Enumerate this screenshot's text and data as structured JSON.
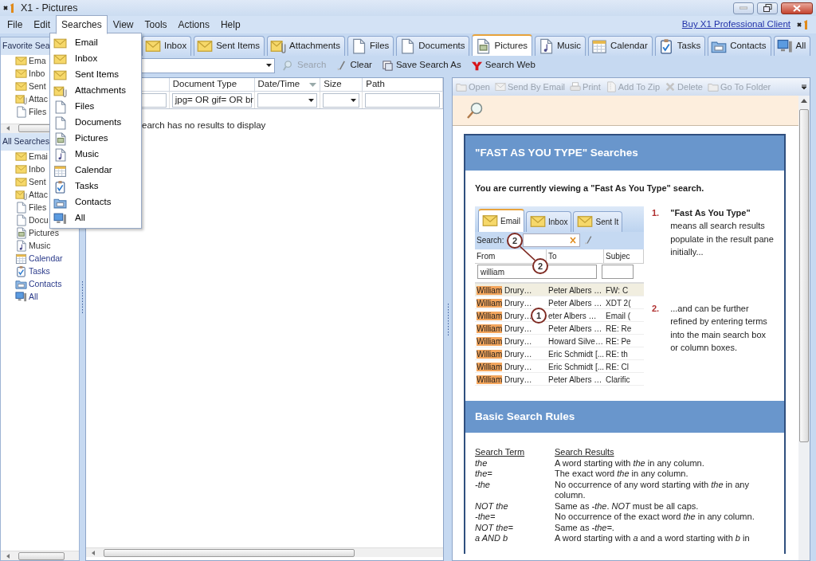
{
  "window": {
    "title": "X1 - Pictures"
  },
  "menu_bar": {
    "items": [
      {
        "label": "File",
        "selected": false
      },
      {
        "label": "Edit",
        "selected": false
      },
      {
        "label": "Searches",
        "selected": true
      },
      {
        "label": "View",
        "selected": false
      },
      {
        "label": "Tools",
        "selected": false
      },
      {
        "label": "Actions",
        "selected": false
      },
      {
        "label": "Help",
        "selected": false
      }
    ],
    "link": "Buy X1 Professional Client"
  },
  "searches_menu": {
    "items": [
      {
        "label": "Email",
        "kind": "email"
      },
      {
        "label": "Inbox",
        "kind": "email"
      },
      {
        "label": "Sent Items",
        "kind": "email"
      },
      {
        "label": "Attachments",
        "kind": "attachments"
      },
      {
        "label": "Files",
        "kind": "files"
      },
      {
        "label": "Documents",
        "kind": "files"
      },
      {
        "label": "Pictures",
        "kind": "pictures"
      },
      {
        "label": "Music",
        "kind": "music"
      },
      {
        "label": "Calendar",
        "kind": "calendar"
      },
      {
        "label": "Tasks",
        "kind": "tasks"
      },
      {
        "label": "Contacts",
        "kind": "contacts"
      },
      {
        "label": "All",
        "kind": "all"
      }
    ]
  },
  "sidebar": {
    "favorites": {
      "title": "Favorite Sea",
      "items": [
        {
          "label": "Ema",
          "kind": "email"
        },
        {
          "label": "Inbo",
          "kind": "email"
        },
        {
          "label": "Sent",
          "kind": "email"
        },
        {
          "label": "Attac",
          "kind": "attachments"
        },
        {
          "label": "Files",
          "kind": "files"
        }
      ]
    },
    "all": {
      "title": "All Searches",
      "items": [
        {
          "label": "Emai",
          "kind": "email"
        },
        {
          "label": "Inbo",
          "kind": "email"
        },
        {
          "label": "Sent",
          "kind": "email"
        },
        {
          "label": "Attac",
          "kind": "attachments"
        },
        {
          "label": "Files",
          "kind": "files"
        },
        {
          "label": "Docu",
          "kind": "files"
        },
        {
          "label": "Pictures",
          "kind": "pictures"
        },
        {
          "label": "Music",
          "kind": "music"
        },
        {
          "label": "Calendar",
          "kind": "calendar"
        },
        {
          "label": "Tasks",
          "kind": "tasks"
        },
        {
          "label": "Contacts",
          "kind": "contacts"
        },
        {
          "label": "All",
          "kind": "all"
        }
      ]
    }
  },
  "tabs": [
    {
      "label": "Inbox",
      "kind": "email",
      "selected": false
    },
    {
      "label": "Sent Items",
      "kind": "email",
      "selected": false
    },
    {
      "label": "Attachments",
      "kind": "attachments",
      "selected": false
    },
    {
      "label": "Files",
      "kind": "files",
      "selected": false
    },
    {
      "label": "Documents",
      "kind": "files",
      "selected": false
    },
    {
      "label": "Pictures",
      "kind": "pictures",
      "selected": true
    },
    {
      "label": "Music",
      "kind": "music",
      "selected": false
    },
    {
      "label": "Calendar",
      "kind": "calendar",
      "selected": false
    },
    {
      "label": "Tasks",
      "kind": "tasks",
      "selected": false
    },
    {
      "label": "Contacts",
      "kind": "contacts",
      "selected": false
    },
    {
      "label": "All",
      "kind": "all",
      "selected": false
    }
  ],
  "search_toolbar": [
    {
      "label": "Search",
      "kind": "search",
      "disabled": true
    },
    {
      "label": "Clear",
      "kind": "clear",
      "disabled": false
    },
    {
      "label": "Save Search As",
      "kind": "save",
      "disabled": false
    },
    {
      "label": "Search Web",
      "kind": "web",
      "disabled": false
    }
  ],
  "results": {
    "columns": [
      {
        "kind": "text",
        "sorted": false
      },
      {
        "label": "Document Type",
        "kind": "text",
        "sorted": false,
        "filter_value": "jpg= OR gif= OR br"
      },
      {
        "label": "Date/Time",
        "kind": "dropdown",
        "sorted": true
      },
      {
        "label": "Size",
        "kind": "dropdown",
        "sorted": false
      },
      {
        "label": "Path",
        "kind": "text",
        "sorted": false
      }
    ],
    "message": "earch has no results to display"
  },
  "preview": {
    "toolbar": [
      {
        "label": "Open",
        "kind": "open",
        "disabled": true
      },
      {
        "label": "Send By Email",
        "kind": "email",
        "disabled": true
      },
      {
        "label": "Print",
        "kind": "print",
        "disabled": true
      },
      {
        "label": "Add To Zip",
        "kind": "zip",
        "disabled": true
      },
      {
        "label": "Delete",
        "kind": "delete",
        "disabled": true
      },
      {
        "label": "Go To Folder",
        "kind": "folder",
        "disabled": true
      }
    ],
    "help": {
      "sections": [
        {
          "title": "\"FAST AS YOU TYPE\" Searches",
          "intro": "You are currently viewing a \"Fast As You Type\" search.",
          "example": {
            "tabs": [
              {
                "label": "Email",
                "selected": true
              },
              {
                "label": "Inbox",
                "selected": false
              },
              {
                "label": "Sent It",
                "selected": false
              }
            ],
            "search_label": "Search:",
            "columns": [
              "From",
              "To",
              "Subjec"
            ],
            "filter": "william",
            "rows": [
              {
                "match": "William",
                "from": "Drury…",
                "to": "Peter Albers …",
                "subject": "FW: C"
              },
              {
                "match": "William",
                "from": "Drury…",
                "to": "Peter Albers …",
                "subject": "XDT 2("
              },
              {
                "match": "William",
                "from": "Drury…",
                "to": "eter Albers …",
                "subject": "Email ("
              },
              {
                "match": "William",
                "from": "Drury…",
                "to": "Peter Albers …",
                "subject": "RE: Re"
              },
              {
                "match": "William",
                "from": "Drury…",
                "to": "Howard Silve…",
                "subject": "RE: Pe"
              },
              {
                "match": "William",
                "from": "Drury…",
                "to": "Eric Schmidt [...",
                "subject": "RE: th"
              },
              {
                "match": "William",
                "from": "Drury…",
                "to": "Eric Schmidt [...",
                "subject": "RE: Cl"
              },
              {
                "match": "William",
                "from": "Drury…",
                "to": "Peter Albers …",
                "subject": "Clarific"
              }
            ],
            "callouts": [
              "2",
              "2",
              "1"
            ]
          },
          "notes": [
            {
              "number": "1.",
              "text": "**\"Fast As You Type\"** means all search results populate in the result pane initially..."
            },
            {
              "number": "2.",
              "text": "...and can be further refined by entering terms into the main search box or column boxes."
            }
          ]
        },
        {
          "title": "Basic Search Rules",
          "rules": {
            "columns": [
              "Search Term",
              "Search Results"
            ],
            "rows": [
              {
                "term": "the",
                "result": "A word starting with *the* in any column."
              },
              {
                "term": "the=",
                "result": "The exact word *the* in any column."
              },
              {
                "term": "-the",
                "result": "No occurrence of any word starting with *the* in any column."
              },
              {
                "term": "NOT the",
                "result": "Same as *-the*. *NOT* must be all caps."
              },
              {
                "term": "-the=",
                "result": "No occurrence of the exact word *the* in any column."
              },
              {
                "term": "NOT the=",
                "result": "Same as *-the=*."
              },
              {
                "term": "a AND b",
                "result": "A word starting with *a* and a word starting with *b* in"
              }
            ]
          }
        }
      ]
    }
  }
}
